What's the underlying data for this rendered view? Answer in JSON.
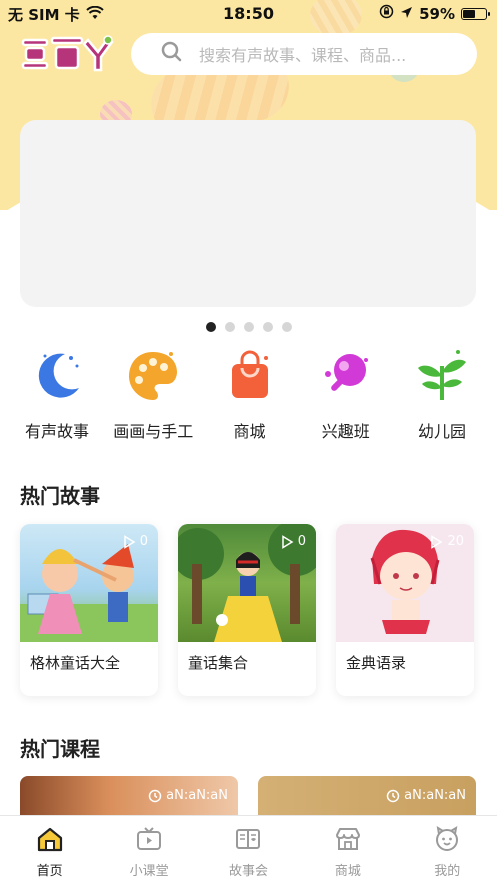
{
  "status_bar": {
    "carrier": "无 SIM 卡",
    "time": "18:50",
    "battery": "59%",
    "battery_level": 0.59
  },
  "header": {
    "logo_text": "豆苗丫",
    "search_placeholder": "搜索有声故事、课程、商品..."
  },
  "banner": {
    "page_count": 5,
    "active_index": 0
  },
  "categories": [
    {
      "label": "有声故事",
      "icon": "moon-icon"
    },
    {
      "label": "画画与手工",
      "icon": "palette-icon"
    },
    {
      "label": "商城",
      "icon": "shopping-bag-icon"
    },
    {
      "label": "兴趣班",
      "icon": "ping-pong-icon"
    },
    {
      "label": "幼儿园",
      "icon": "sprout-icon"
    }
  ],
  "hot_stories": {
    "title": "热门故事",
    "items": [
      {
        "title": "格林童话大全",
        "count": "0"
      },
      {
        "title": "童话集合",
        "count": "0"
      },
      {
        "title": "金典语录",
        "count": "20"
      }
    ]
  },
  "hot_courses": {
    "title": "热门课程",
    "items": [
      {
        "duration": "aN:aN:aN"
      },
      {
        "duration": "aN:aN:aN"
      }
    ]
  },
  "tabbar": {
    "items": [
      {
        "label": "首页",
        "icon": "home-icon",
        "active": true
      },
      {
        "label": "小课堂",
        "icon": "tv-icon",
        "active": false
      },
      {
        "label": "故事会",
        "icon": "book-icon",
        "active": false
      },
      {
        "label": "商城",
        "icon": "store-icon",
        "active": false
      },
      {
        "label": "我的",
        "icon": "face-icon",
        "active": false
      }
    ]
  },
  "colors": {
    "header_bg": "#fce7a2",
    "accent": "#f0b93a",
    "logo": "#b5347a"
  }
}
